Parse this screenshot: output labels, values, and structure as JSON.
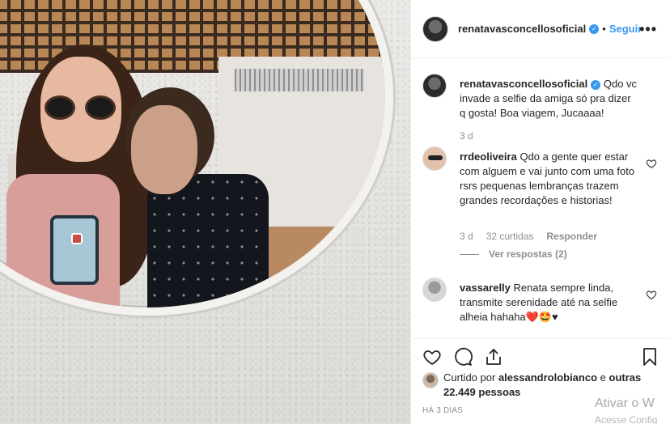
{
  "post": {
    "author": "renatavasconcellosoficial",
    "follow_label": "Seguir",
    "separator": "•",
    "more_label": "•••"
  },
  "caption": {
    "author": "renatavasconcellosoficial",
    "text": "Qdo vc invade a selfie da amiga só pra dizer q gosta! Boa viagem, Jucaaaa!",
    "age": "3 d"
  },
  "comments": [
    {
      "user": "rrdeoliveira",
      "text": "Qdo a gente quer estar com alguem e vai junto com uma foto rsrs pequenas lembranças trazem grandes recordações e historias!",
      "age": "3 d",
      "likes": "32 curtidas",
      "reply_label": "Responder",
      "view_replies": "Ver respostas (2)"
    },
    {
      "user": "vassarelly",
      "text": "Renata sempre linda, transmite serenidade até na selfie alheia hahaha❤️🤩♥"
    }
  ],
  "liked_by": {
    "prefix": "Curtido por",
    "user": "alessandrolobianco",
    "connector": "e",
    "others": "outras 22.449 pessoas"
  },
  "timestamp": "HÁ 3 DIAS",
  "watermark": {
    "line1": "Ativar o W",
    "line2": "Acesse Config"
  },
  "icons": [
    "heart-icon",
    "comment-icon",
    "share-icon",
    "bookmark-icon",
    "verified-badge-icon",
    "more-options-icon"
  ],
  "colors": {
    "link": "#3897f0",
    "muted": "#8e8e8e",
    "text": "#262626",
    "verified": "#3897f0"
  }
}
